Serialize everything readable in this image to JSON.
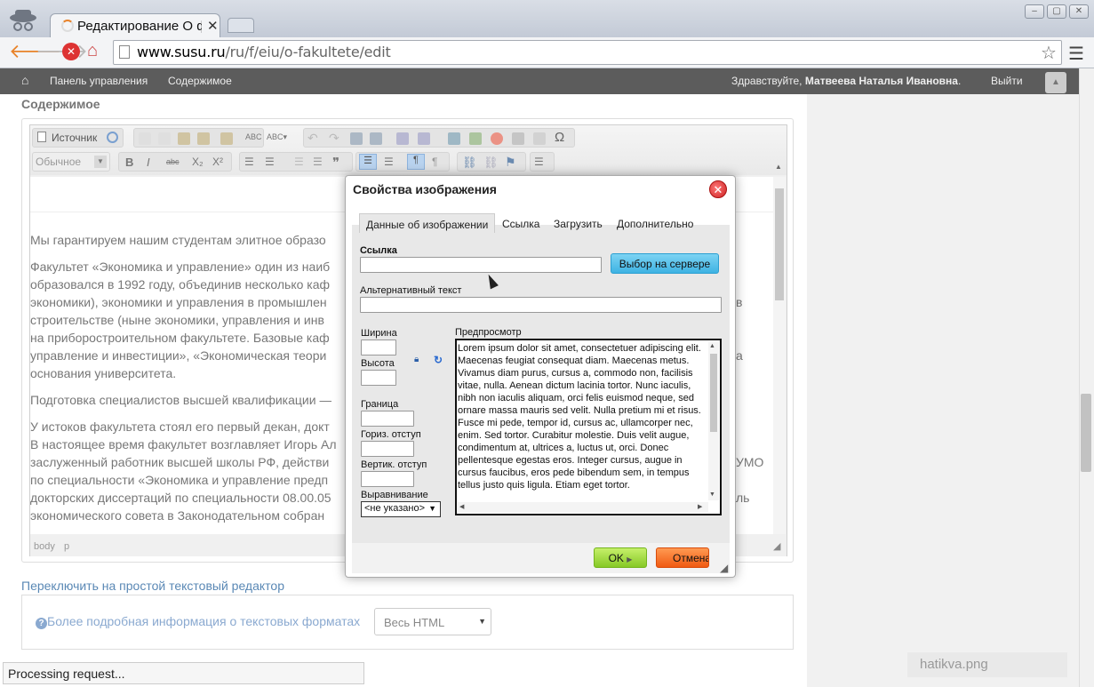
{
  "browser": {
    "tab_title": "Редактирование О ф",
    "url_host": "www.susu.ru",
    "url_path": "/ru/f/eiu/o-fakultete/edit",
    "status_text": "Processing request..."
  },
  "adminbar": {
    "panel": "Панель управления",
    "content": "Содержимое",
    "greeting": "Здравствуйте,",
    "user": "Матвеева Наталья Ивановна",
    "logout": "Выйти"
  },
  "page": {
    "section_title": "Содержимое",
    "switch_editor": "Переключить на простой текстовый редактор",
    "formats_info": "Более подробная информация о текстовых форматах",
    "format_value": "Весь HTML",
    "download_file": "hatikva.png"
  },
  "editor": {
    "source_label": "Источник",
    "format_value": "Обычное",
    "path_body": "body",
    "path_p": "p",
    "paragraphs": [
      "Мы гарантируем нашим студентам элитное образо",
      "Факультет «Экономика и управление» один из наиб",
      "образовался в 1992 году, объединив несколько каф",
      "экономики), экономики и управления в промышлен",
      "строительстве (ныне экономики, управления и инв",
      "на приборостроительном факультете. Базовые каф",
      "управление и инвестиции», «Экономическая теори",
      "основания университета.",
      "Подготовка специалистов высшей квалификации —",
      "У истоков факультета стоял его первый декан, докт",
      "В настоящее время факультет возглавляет Игорь Ал",
      "заслуженный работник высшей школы РФ, действи",
      "по специальности «Экономика и управление предп",
      "докторских диссертаций по специальности 08.00.05",
      "экономического совета в Законодательном собран"
    ],
    "right_fragments": [
      "в",
      "а",
      "УМО",
      "ль"
    ]
  },
  "dialog": {
    "title": "Свойства изображения",
    "tabs": [
      "Данные об изображении",
      "Ссылка",
      "Загрузить",
      "Дополнительно"
    ],
    "url_label": "Ссылка",
    "browse_button": "Выбор на сервере",
    "alt_label": "Альтернативный текст",
    "width_label": "Ширина",
    "height_label": "Высота",
    "border_label": "Граница",
    "hspace_label": "Гориз. отступ",
    "vspace_label": "Вертик. отступ",
    "align_label": "Выравнивание",
    "align_value": "<не указано>",
    "preview_label": "Предпросмотр",
    "preview_text": "Lorem ipsum dolor sit amet, consectetuer adipiscing elit. Maecenas feugiat consequat diam. Maecenas metus. Vivamus diam purus, cursus a, commodo non, facilisis vitae, nulla. Aenean dictum lacinia tortor. Nunc iaculis, nibh non iaculis aliquam, orci felis euismod neque, sed ornare massa mauris sed velit. Nulla pretium mi et risus. Fusce mi pede, tempor id, cursus ac, ullamcorper nec, enim. Sed tortor. Curabitur molestie. Duis velit augue, condimentum at, ultrices a, luctus ut, orci. Donec pellentesque egestas eros. Integer cursus, augue in cursus faucibus, eros pede bibendum sem, in tempus tellus justo quis ligula. Etiam eget tortor.",
    "ok": "OK",
    "cancel": "Отмена"
  }
}
